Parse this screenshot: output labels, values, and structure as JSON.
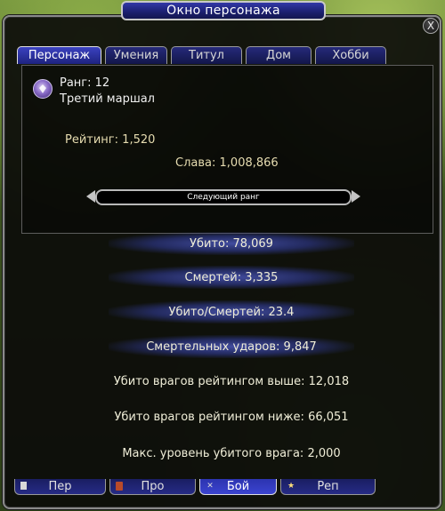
{
  "window": {
    "title": "Окно персонажа",
    "close_label": "X"
  },
  "tabs": [
    {
      "label": "Персонаж",
      "active": true
    },
    {
      "label": "Умения",
      "active": false
    },
    {
      "label": "Титул",
      "active": false
    },
    {
      "label": "Дом",
      "active": false
    },
    {
      "label": "Хобби",
      "active": false
    }
  ],
  "rank": {
    "icon": "rank-badge-icon",
    "rank_label": "Ранг:",
    "rank_value": "12",
    "title": "Третий маршал",
    "rating_label": "Рейтинг:",
    "rating_value": "1,520",
    "glory_label": "Слава:",
    "glory_value": "1,008,866",
    "next_rank_label": "Следующий ранг"
  },
  "stats": [
    {
      "label": "Убито:",
      "value": "78,069"
    },
    {
      "label": "Смертей:",
      "value": "3,335"
    },
    {
      "label": "Убито/Смертей:",
      "value": "23.4"
    },
    {
      "label": "Смертельных ударов:",
      "value": "9,847"
    },
    {
      "label": "Убито врагов рейтингом выше:",
      "value": "12,018"
    },
    {
      "label": "Убито врагов рейтингом ниже:",
      "value": "66,051"
    },
    {
      "label": "Макс. уровень убитого врага:",
      "value": "2,000"
    }
  ],
  "bottom_tabs": [
    {
      "label": "Пер",
      "icon": "document-icon",
      "active": false
    },
    {
      "label": "Про",
      "icon": "book-icon",
      "active": false
    },
    {
      "label": "Бой",
      "icon": "sword-icon",
      "active": true
    },
    {
      "label": "Реп",
      "icon": "star-icon",
      "active": false
    }
  ],
  "colors": {
    "title_bar": "#1b1f6e",
    "tab_active": "#3b42c0",
    "stat_glow": "#4a56b8",
    "text_gold": "#e6dcb0"
  }
}
